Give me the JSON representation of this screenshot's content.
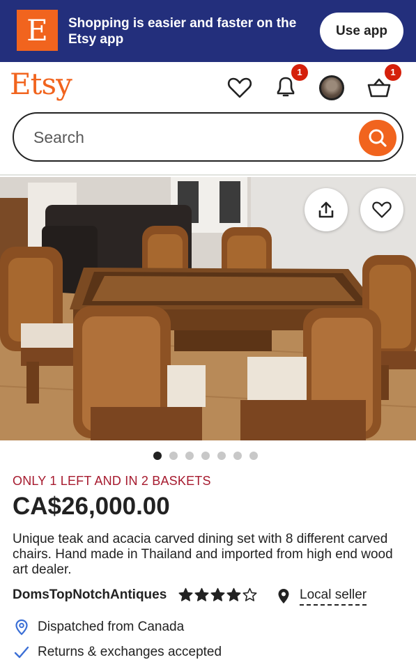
{
  "banner": {
    "logo_letter": "E",
    "text": "Shopping is easier and faster on the Etsy app",
    "button_label": "Use app"
  },
  "header": {
    "logo": "Etsy",
    "notifications_count": "1",
    "basket_count": "1",
    "icons": [
      "heart-icon",
      "bell-icon",
      "avatar",
      "basket-icon"
    ]
  },
  "search": {
    "placeholder": "Search"
  },
  "gallery": {
    "image_count": 7,
    "active_index": 0
  },
  "listing": {
    "stock_note": "ONLY 1 LEFT AND IN 2 BASKETS",
    "price": "CA$26,000.00",
    "description": "Unique teak and acacia carved dining set with 8 different carved chairs. Hand made in Thailand and imported from high end wood art dealer.",
    "shop_name": "DomsTopNotchAntiques",
    "rating": 4,
    "rating_max": 5,
    "local_seller": "Local seller",
    "dispatched": "Dispatched from Canada",
    "returns": "Returns & exchanges accepted"
  },
  "colors": {
    "brand": "#f1641e",
    "banner": "#232f7c",
    "alert": "#a61a2e",
    "badge": "#d5200b",
    "pin_blue": "#3b6fd6"
  }
}
